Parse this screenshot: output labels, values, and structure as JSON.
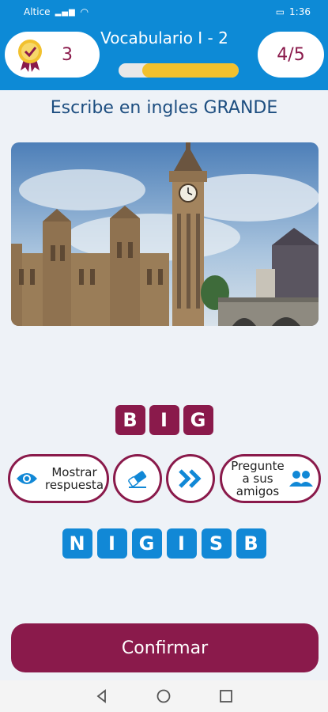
{
  "status": {
    "carrier": "Altice",
    "time": "1:36",
    "battery_icon": "battery-icon"
  },
  "header": {
    "score": "3",
    "title": "Vocabulario I - 2",
    "progress_label": "4/5",
    "progress_fraction": 0.8,
    "colors": {
      "bar": "#0d8ad6",
      "accent": "#8a1a4b",
      "progress": "#f2c12e"
    }
  },
  "question": {
    "text": "Escribe en ingles GRANDE"
  },
  "answer": {
    "letters": [
      "B",
      "I",
      "G"
    ]
  },
  "tools": {
    "show_answer": "Mostrar respuesta",
    "ask_friends": "Pregunte a sus amigos"
  },
  "letters": [
    "N",
    "I",
    "G",
    "I",
    "S",
    "B"
  ],
  "confirm_label": "Confirmar"
}
